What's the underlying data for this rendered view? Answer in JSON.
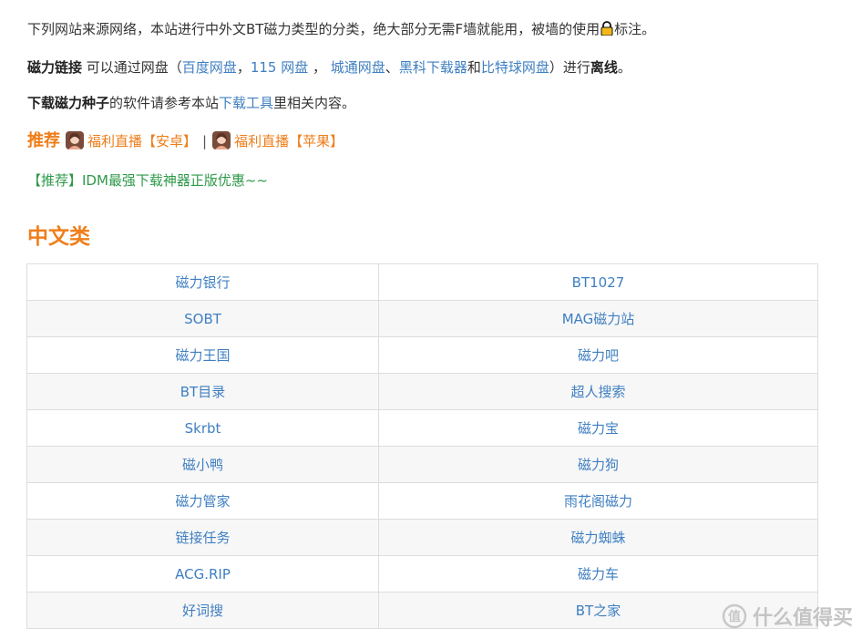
{
  "intro": {
    "text_before_icon": "下列网站来源网络，本站进行中外文BT磁力类型的分类，绝大部分无需F墙就能用，被墙的使用",
    "text_after_icon": "标注。"
  },
  "magnet": {
    "bold_label": "磁力链接",
    "text1": " 可以通过网盘（",
    "link1": "百度网盘",
    "sep1": "，",
    "link2": "115 网盘",
    "sep2": " ， ",
    "link3": "城通网盘",
    "sep3": "、",
    "link4": "黑科下载器",
    "sep4": "和",
    "link5": "比特球网盘",
    "text2": "）进行",
    "bold_end": "离线",
    "end": "。"
  },
  "download": {
    "bold_label": "下载磁力种子",
    "text1": "的软件请参考本站",
    "link": "下载工具",
    "text2": "里相关内容。"
  },
  "recommend": {
    "title": "推荐",
    "link1": "福利直播【安卓】",
    "separator": "|",
    "link2": "福利直播【苹果】"
  },
  "promo": {
    "text": "【推荐】IDM最强下载神器正版优惠~~"
  },
  "section": {
    "title": "中文类"
  },
  "table": {
    "rows": [
      [
        "磁力银行",
        "BT1027"
      ],
      [
        "SOBT",
        "MAG磁力站"
      ],
      [
        "磁力王国",
        "磁力吧"
      ],
      [
        "BT目录",
        "超人搜索"
      ],
      [
        "Skrbt",
        "磁力宝"
      ],
      [
        "磁小鸭",
        "磁力狗"
      ],
      [
        "磁力管家",
        "雨花阁磁力"
      ],
      [
        "链接任务",
        "磁力蜘蛛"
      ],
      [
        "ACG.RIP",
        "磁力车"
      ],
      [
        "好词搜",
        "BT之家"
      ]
    ]
  },
  "watermark": {
    "text": "什么值得买"
  },
  "colors": {
    "link": "#3f7fc1",
    "accent": "#f07f1b",
    "green": "#2e9a4a"
  },
  "icons": {
    "lock": "lock-icon",
    "avatar": "avatar-image",
    "watermark_logo": "zhi-logo-icon"
  }
}
